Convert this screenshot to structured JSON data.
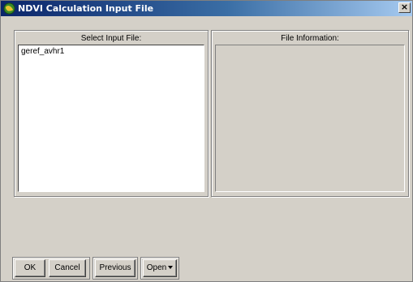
{
  "window": {
    "title": "NDVI Calculation Input File",
    "close_label": "×"
  },
  "left_panel": {
    "label": "Select Input File:",
    "files": [
      "geref_avhr1"
    ]
  },
  "right_panel": {
    "label": "File Information:"
  },
  "buttons": {
    "ok": "OK",
    "cancel": "Cancel",
    "previous": "Previous",
    "open": "Open"
  }
}
